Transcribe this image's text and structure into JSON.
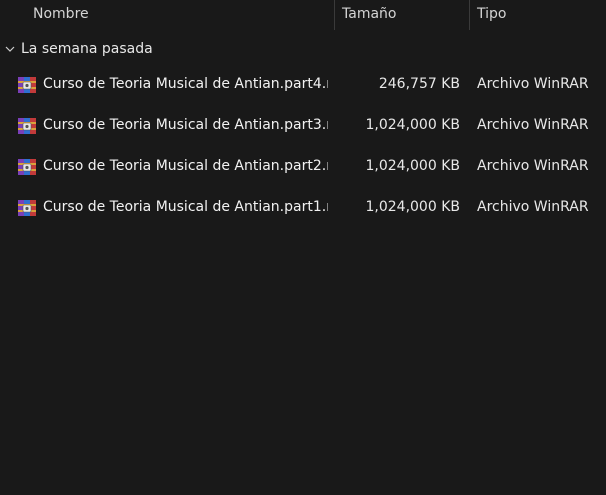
{
  "columns": {
    "name": "Nombre",
    "size": "Tamaño",
    "type": "Tipo"
  },
  "group": {
    "label": "La semana pasada",
    "icon": "chevron-down-icon"
  },
  "files": [
    {
      "name": "Curso de Teoria Musical de Antian.part4.r...",
      "size": "246,757 KB",
      "type": "Archivo WinRAR",
      "icon": "winrar-archive-icon"
    },
    {
      "name": "Curso de Teoria Musical de Antian.part3.r...",
      "size": "1,024,000 KB",
      "type": "Archivo WinRAR",
      "icon": "winrar-archive-icon"
    },
    {
      "name": "Curso de Teoria Musical de Antian.part2.r...",
      "size": "1,024,000 KB",
      "type": "Archivo WinRAR",
      "icon": "winrar-archive-icon"
    },
    {
      "name": "Curso de Teoria Musical de Antian.part1.r...",
      "size": "1,024,000 KB",
      "type": "Archivo WinRAR",
      "icon": "winrar-archive-icon"
    }
  ],
  "colors": {
    "background": "#191919",
    "text": "#f2f2f2",
    "divider": "#3a3a3a"
  }
}
